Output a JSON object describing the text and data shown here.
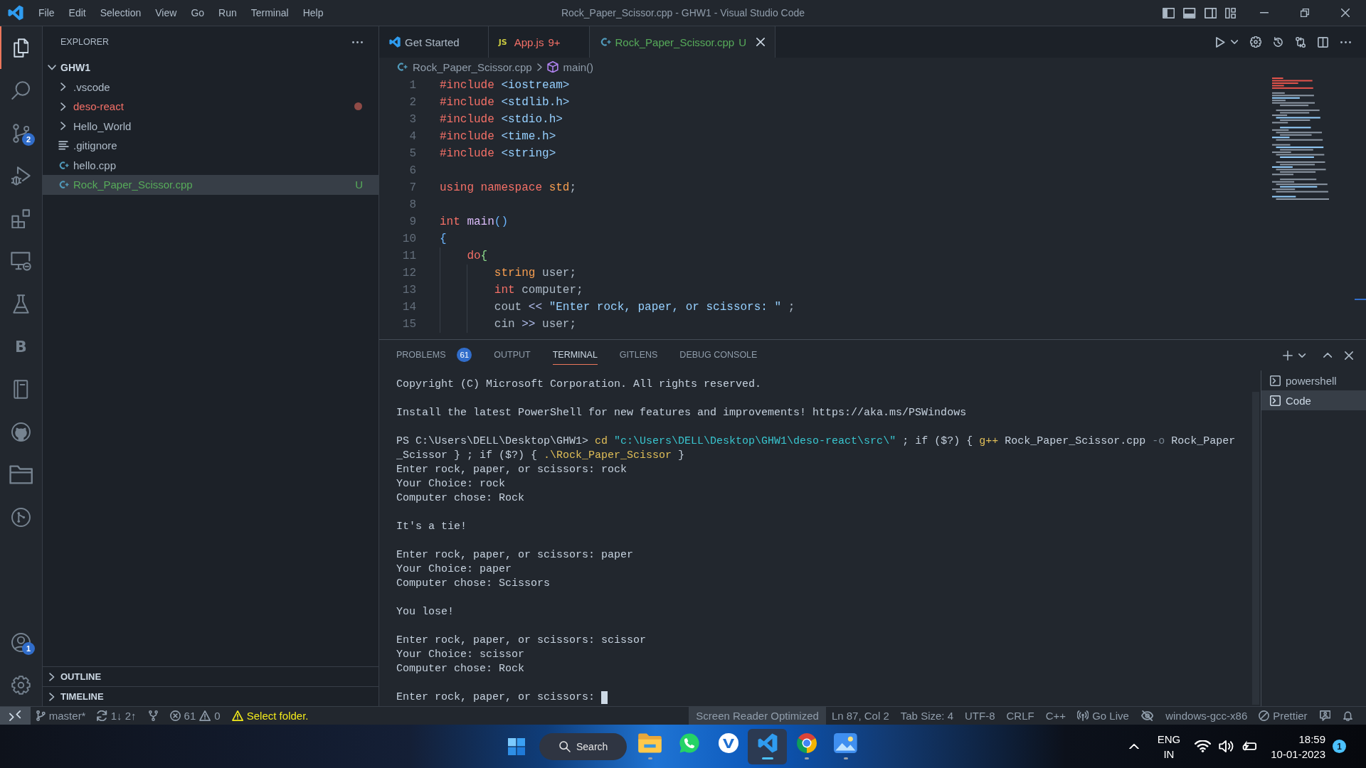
{
  "window": {
    "title": "Rock_Paper_Scissor.cpp - GHW1 - Visual Studio Code"
  },
  "menu": [
    "File",
    "Edit",
    "Selection",
    "View",
    "Go",
    "Run",
    "Terminal",
    "Help"
  ],
  "activity_bar": {
    "top": [
      {
        "kind": "files",
        "selected": true
      },
      {
        "kind": "search",
        "selected": false
      },
      {
        "kind": "source-control",
        "selected": false,
        "badge": "2"
      },
      {
        "kind": "run-debug",
        "selected": false
      },
      {
        "kind": "extensions",
        "selected": false
      },
      {
        "kind": "remote",
        "selected": false
      },
      {
        "kind": "flask",
        "selected": false
      },
      {
        "kind": "letter",
        "text": "B",
        "selected": false
      },
      {
        "kind": "notebook",
        "selected": false
      },
      {
        "kind": "cat",
        "selected": false
      },
      {
        "kind": "folder",
        "selected": false
      },
      {
        "kind": "branch-circle",
        "selected": false
      }
    ],
    "bottom": [
      {
        "kind": "account",
        "badge": "1"
      },
      {
        "kind": "gear"
      }
    ]
  },
  "sidebar": {
    "title": "EXPLORER",
    "root": {
      "label": "GHW1",
      "expanded": true,
      "children": [
        {
          "kind": "folder",
          "label": ".vscode",
          "expanded": false,
          "color": "#adbac7",
          "dot": false,
          "selected": false
        },
        {
          "kind": "folder",
          "label": "deso-react",
          "expanded": false,
          "color": "#f47067",
          "dot": true,
          "selected": false
        },
        {
          "kind": "folder",
          "label": "Hello_World",
          "expanded": false,
          "color": "#adbac7",
          "dot": false,
          "selected": false
        },
        {
          "kind": "text-file",
          "label": ".gitignore",
          "color": "#adbac7",
          "dot": false,
          "selected": false
        },
        {
          "kind": "cpp-file",
          "label": "hello.cpp",
          "color": "#adbac7",
          "dot": false,
          "selected": false
        },
        {
          "kind": "cpp-file",
          "label": "Rock_Paper_Scissor.cpp",
          "color": "#57ab5a",
          "dot": false,
          "selected": true,
          "status": "U"
        }
      ]
    },
    "sections": [
      {
        "label": "OUTLINE",
        "expanded": false
      },
      {
        "label": "TIMELINE",
        "expanded": false
      }
    ]
  },
  "tabs": [
    {
      "kind": "welcome",
      "label": "Get Started",
      "selected": false,
      "color": "#adbac7"
    },
    {
      "kind": "js",
      "icon_text": "JS",
      "label": "App.js",
      "status": "9+",
      "selected": false,
      "color": "#f47067"
    },
    {
      "kind": "cpp",
      "label": "Rock_Paper_Scissor.cpp",
      "status": "U",
      "selected": true,
      "color": "#57ab5a"
    }
  ],
  "breadcrumb": [
    {
      "kind": "file",
      "label": "Rock_Paper_Scissor.cpp"
    },
    {
      "kind": "function",
      "label": "main()"
    }
  ],
  "editor": {
    "lines": [
      {
        "number": "1",
        "tokens": [
          {
            "kind": "keyword",
            "text": "#include"
          },
          {
            "kind": "header",
            "text": " <iostream>"
          }
        ]
      },
      {
        "number": "2",
        "tokens": [
          {
            "kind": "keyword",
            "text": "#include"
          },
          {
            "kind": "header",
            "text": " <stdlib.h>"
          }
        ]
      },
      {
        "number": "3",
        "tokens": [
          {
            "kind": "keyword",
            "text": "#include"
          },
          {
            "kind": "header",
            "text": " <stdio.h>"
          }
        ]
      },
      {
        "number": "4",
        "tokens": [
          {
            "kind": "keyword",
            "text": "#include"
          },
          {
            "kind": "header",
            "text": " <time.h>"
          }
        ]
      },
      {
        "number": "5",
        "tokens": [
          {
            "kind": "keyword",
            "text": "#include"
          },
          {
            "kind": "header",
            "text": " <string>"
          }
        ]
      },
      {
        "number": "6"
      },
      {
        "number": "7",
        "tokens": [
          {
            "kind": "keyword",
            "text": "using namespace"
          },
          {
            "kind": "type",
            "text": " std"
          },
          {
            "kind": "plain",
            "text": ";"
          }
        ]
      },
      {
        "number": "8"
      },
      {
        "number": "9",
        "tokens": [
          {
            "kind": "keyword",
            "text": "int"
          },
          {
            "kind": "function",
            "text": " main"
          },
          {
            "kind": "bracket-1",
            "text": "()"
          }
        ]
      },
      {
        "number": "10",
        "tokens": [
          {
            "kind": "bracket-1",
            "text": "{"
          }
        ]
      },
      {
        "number": "11",
        "tokens": [
          {
            "kind": "keyword",
            "text": "    do"
          },
          {
            "kind": "bracket-2",
            "text": "{"
          }
        ]
      },
      {
        "number": "12",
        "tokens": [
          {
            "kind": "type",
            "text": "        string"
          },
          {
            "kind": "plain",
            "text": " user;"
          }
        ]
      },
      {
        "number": "13",
        "tokens": [
          {
            "kind": "keyword",
            "text": "        int"
          },
          {
            "kind": "plain",
            "text": " computer;"
          }
        ]
      },
      {
        "number": "14",
        "tokens": [
          {
            "kind": "plain",
            "text": "        cout"
          },
          {
            "kind": "operator",
            "text": " <<"
          },
          {
            "kind": "string",
            "text": " \"Enter rock, paper, or scissors: \""
          },
          {
            "kind": "plain",
            "text": " ;"
          }
        ]
      },
      {
        "number": "15",
        "tokens": [
          {
            "kind": "plain",
            "text": "        cin"
          },
          {
            "kind": "operator",
            "text": " >>"
          },
          {
            "kind": "plain",
            "text": " user;"
          }
        ]
      }
    ]
  },
  "panel": {
    "tabs": [
      {
        "label": "PROBLEMS",
        "count": "61",
        "selected": false
      },
      {
        "label": "OUTPUT",
        "selected": false
      },
      {
        "label": "TERMINAL",
        "selected": true
      },
      {
        "label": "GITLENS",
        "selected": false
      },
      {
        "label": "DEBUG CONSOLE",
        "selected": false
      }
    ],
    "terminal": {
      "blocks": [
        [
          "Copyright (C) Microsoft Corporation. All rights reserved."
        ],
        [
          "Install the latest PowerShell for new features and improvements! https://aka.ms/PSWindows"
        ],
        [
          [
            {
              "kind": "plain",
              "text": "PS C:\\Users\\DELL\\Desktop\\GHW1> "
            },
            {
              "kind": "command",
              "text": "cd"
            },
            {
              "kind": "string",
              "text": " \"c:\\Users\\DELL\\Desktop\\GHW1\\deso-react\\src\\\""
            },
            {
              "kind": "plain",
              "text": " ; if ($?) { "
            },
            {
              "kind": "command",
              "text": "g++"
            },
            {
              "kind": "plain",
              "text": " Rock_Paper_Scissor.cpp "
            },
            {
              "kind": "flag",
              "text": "-o"
            },
            {
              "kind": "plain",
              "text": " Rock_Paper"
            }
          ],
          [
            {
              "kind": "plain",
              "text": "_Scissor } ; if ($?) { "
            },
            {
              "kind": "command",
              "text": ".\\Rock_Paper_Scissor"
            },
            {
              "kind": "plain",
              "text": " }"
            }
          ],
          "Enter rock, paper, or scissors: rock",
          "Your Choice: rock",
          "Computer chose: Rock"
        ],
        [
          "It's a tie!"
        ],
        [
          "Enter rock, paper, or scissors: paper",
          "Your Choice: paper",
          "Computer chose: Scissors"
        ],
        [
          "You lose!"
        ],
        [
          "Enter rock, paper, or scissors: scissor",
          "Your Choice: scissor",
          "Computer chose: Rock"
        ],
        [
          "Enter rock, paper, or scissors:"
        ]
      ],
      "cursor": true
    },
    "terminals": [
      {
        "label": "powershell",
        "selected": false
      },
      {
        "label": "Code",
        "selected": true
      }
    ]
  },
  "status_bar": {
    "left": [
      {
        "kind": "remote"
      },
      {
        "kind": "branch",
        "text": "master*"
      },
      {
        "kind": "sync",
        "text": "1↓ 2↑"
      },
      {
        "kind": "graph"
      },
      {
        "kind": "problems",
        "errors": "61",
        "warnings": "0"
      },
      {
        "kind": "warning",
        "text": "Select folder."
      }
    ],
    "right": [
      {
        "kind": "highlight",
        "text": "Screen Reader Optimized"
      },
      {
        "kind": "text",
        "text": "Ln 87, Col 2"
      },
      {
        "kind": "text",
        "text": "Tab Size: 4"
      },
      {
        "kind": "text",
        "text": "UTF-8"
      },
      {
        "kind": "text",
        "text": "CRLF"
      },
      {
        "kind": "text",
        "text": "C++"
      },
      {
        "kind": "broadcast",
        "text": "Go Live"
      },
      {
        "kind": "eye-slash"
      },
      {
        "kind": "text",
        "text": "windows-gcc-x86"
      },
      {
        "kind": "circle-slash",
        "text": "Prettier"
      },
      {
        "kind": "feedback"
      },
      {
        "kind": "bell"
      }
    ]
  },
  "taskbar": {
    "search": {
      "label": "Search"
    },
    "apps": [
      {
        "kind": "folder",
        "running": true,
        "selected": false
      },
      {
        "kind": "chat",
        "running": false,
        "selected": false
      },
      {
        "kind": "circle-app",
        "running": false,
        "selected": false
      },
      {
        "kind": "code",
        "running": true,
        "selected": true
      },
      {
        "kind": "browser",
        "running": true,
        "selected": false
      },
      {
        "kind": "photos",
        "running": true,
        "selected": false
      }
    ],
    "tray": {
      "language": "ENG",
      "region": "IN",
      "time": "18:59",
      "date": "10-01-2023",
      "notifications": "1"
    }
  }
}
